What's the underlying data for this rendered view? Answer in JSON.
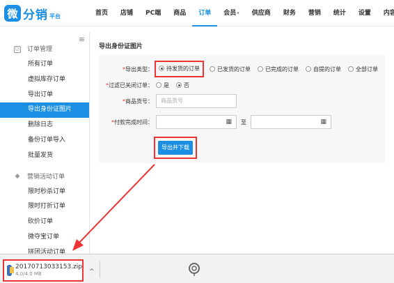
{
  "brand": {
    "mark": "微",
    "name": "分销",
    "sub": "平台",
    "color": "#1a8fe3"
  },
  "nav": [
    {
      "label": "首页",
      "active": false
    },
    {
      "label": "店铺",
      "active": false
    },
    {
      "label": "PC端",
      "active": false
    },
    {
      "label": "商品",
      "active": false
    },
    {
      "label": "订单",
      "active": true
    },
    {
      "label": "会员",
      "active": false,
      "caret": "▾"
    },
    {
      "label": "供应商",
      "active": false
    },
    {
      "label": "财务",
      "active": false
    },
    {
      "label": "营销",
      "active": false
    },
    {
      "label": "统计",
      "active": false
    },
    {
      "label": "设置",
      "active": false
    },
    {
      "label": "内容电商",
      "active": false
    }
  ],
  "sidebar": {
    "toggle_icon": "≡",
    "group1": {
      "label": "订单管理",
      "icon": "☑"
    },
    "items1": [
      "所有订单",
      "虚拟库存订单",
      "导出订单",
      "导出身份证图片",
      "删除日志",
      "备份订单导入",
      "批量发货"
    ],
    "active_item": "导出身份证图片",
    "group2": {
      "label": "营销活动订单",
      "icon": "◆"
    },
    "items2": [
      "限时秒杀订单",
      "限时打折订单",
      "砍价订单",
      "微夺宝订单",
      "拼团活动订单"
    ]
  },
  "panel": {
    "title": "导出身份证图片",
    "export_type": {
      "label": "导出类型：",
      "options": [
        "待发货的订单",
        "已发货的订单",
        "已完成的订单",
        "自提的订单",
        "全部订单"
      ],
      "selected": "待发货的订单"
    },
    "filter_closed": {
      "label": "过滤已关闭订单：",
      "options": [
        "是",
        "否"
      ],
      "selected": "否"
    },
    "product_code": {
      "label": "商品货号：",
      "placeholder": "商品货号"
    },
    "paid_time": {
      "label": "付款完成时间：",
      "to": "至",
      "cal_icon": "▦"
    },
    "submit_label": "导出并下载"
  },
  "download": {
    "filename": "20170713033153.zip",
    "size": "4.0/4.0 MB",
    "caret": "^"
  },
  "colors": {
    "accent": "#1a8fe3",
    "highlight": "#e33"
  }
}
